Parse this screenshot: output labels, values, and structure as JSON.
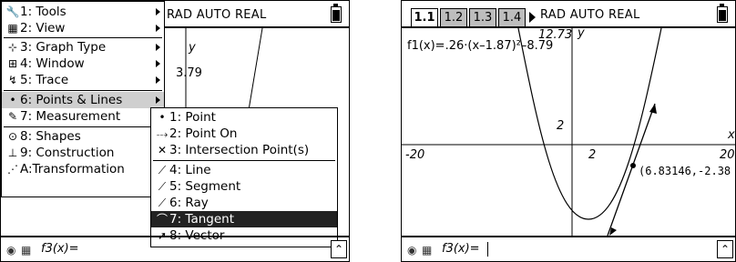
{
  "left_screen": {
    "status": "RAD AUTO REAL",
    "axis_y_label": "y",
    "axis_y_value_fragment": "3.79",
    "menu": {
      "items": [
        {
          "label": "1: Tools",
          "icon": "tools-icon",
          "has_submenu": true
        },
        {
          "label": "2: View",
          "icon": "view-icon",
          "has_submenu": true
        },
        {
          "label": "3: Graph Type",
          "icon": "graph-type-icon",
          "has_submenu": true
        },
        {
          "label": "4: Window",
          "icon": "window-icon",
          "has_submenu": true
        },
        {
          "label": "5: Trace",
          "icon": "trace-icon",
          "has_submenu": true
        },
        {
          "label": "6: Points & Lines",
          "icon": "bullet-icon",
          "has_submenu": true,
          "highlighted": true
        },
        {
          "label": "7: Measurement",
          "icon": "ruler-icon",
          "has_submenu": true
        },
        {
          "label": "8: Shapes",
          "icon": "shapes-icon",
          "has_submenu": true
        },
        {
          "label": "9: Construction",
          "icon": "construction-icon",
          "has_submenu": true
        },
        {
          "label": "A:Transformation",
          "icon": "transformation-icon",
          "has_submenu": true
        }
      ]
    },
    "submenu": {
      "items": [
        {
          "label": "1: Point",
          "icon": "bullet-icon"
        },
        {
          "label": "2: Point On",
          "icon": "point-on-icon"
        },
        {
          "label": "3: Intersection Point(s)",
          "icon": "intersection-icon"
        },
        {
          "label": "4: Line",
          "icon": "line-icon"
        },
        {
          "label": "5: Segment",
          "icon": "segment-icon"
        },
        {
          "label": "6: Ray",
          "icon": "ray-icon"
        },
        {
          "label": "7: Tangent",
          "icon": "tangent-icon",
          "selected": true
        },
        {
          "label": "8: Vector",
          "icon": "vector-icon"
        }
      ]
    },
    "entry_line": "f3(x)="
  },
  "right_screen": {
    "tabs": [
      "1.1",
      "1.2",
      "1.3",
      "1.4"
    ],
    "active_tab": "1.1",
    "status": "RAD AUTO REAL",
    "function_label": "f1(x)=.26·(x–1.87)²–8.79",
    "y_max_label": "12.73",
    "y_axis_label": "y",
    "x_axis_label": "x",
    "x_min_label": "-20",
    "x_max_label": "20",
    "x_tick_label": "2",
    "y_tick_label": "2",
    "point_label": "(6.83146,-2.38",
    "entry_line": "f3(x)="
  }
}
